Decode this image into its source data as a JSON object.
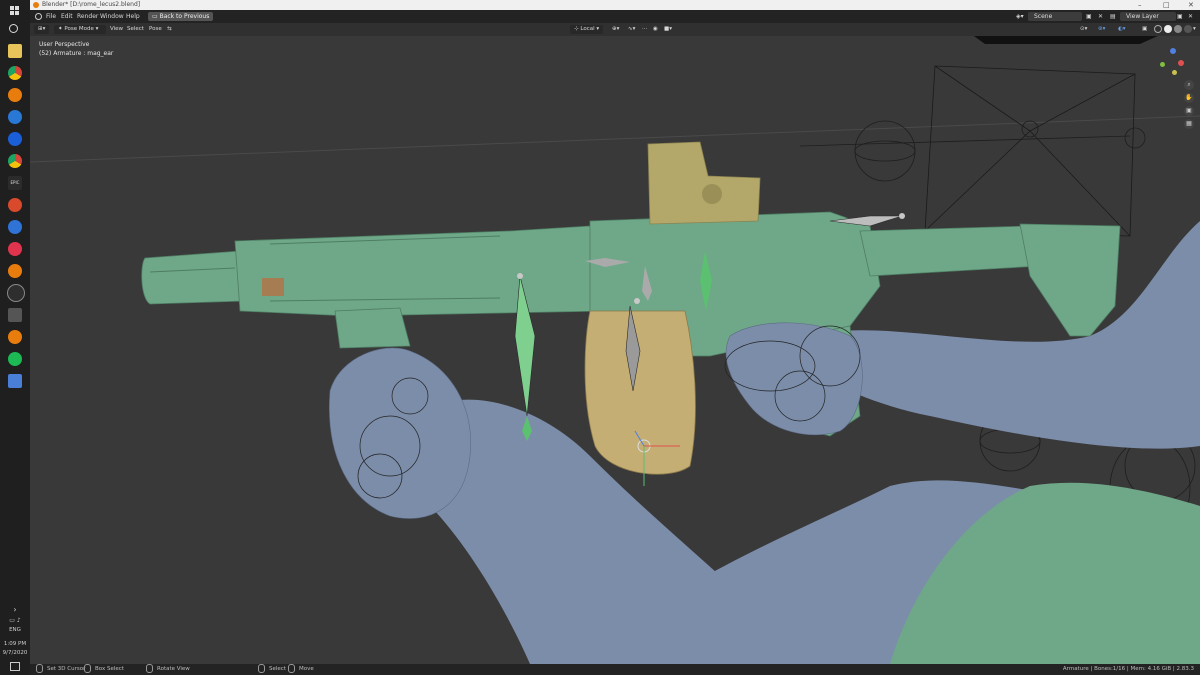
{
  "window": {
    "title": "Blender* [D:\\rome_lecus2.blend]"
  },
  "taskbar": {
    "time": "1:09 PM",
    "date": "9/7/2020",
    "language": "ENG",
    "epic_label": "EPIC"
  },
  "menubar": {
    "items": [
      "File",
      "Edit",
      "Render",
      "Window",
      "Help"
    ],
    "back_label": "Back to Previous",
    "scene_label": "Scene",
    "view_layer_label": "View Layer"
  },
  "viewport_header": {
    "mode": "Pose Mode",
    "menus": [
      "View",
      "Select",
      "Pose"
    ],
    "orientation": "Local"
  },
  "viewport": {
    "perspective": "User Perspective",
    "active_object": "(52) Armature : mag_ear",
    "gizmo_axes": [
      "X",
      "Y",
      "Z"
    ]
  },
  "statusbar": {
    "hints": [
      "Set 3D Cursor",
      "Box Select",
      "Rotate View",
      "Select",
      "Move"
    ],
    "stats": "Armature | Bones:1/16 | Mem: 4.16 GiB | 2.83.3"
  },
  "colors": {
    "weapon": "#6ea888",
    "hand_skin": "#7c8daa",
    "drum_mag": "#c5ae73",
    "sight": "#b3a86a",
    "watch": "#b66a96",
    "viewport_bg": "#393939"
  }
}
